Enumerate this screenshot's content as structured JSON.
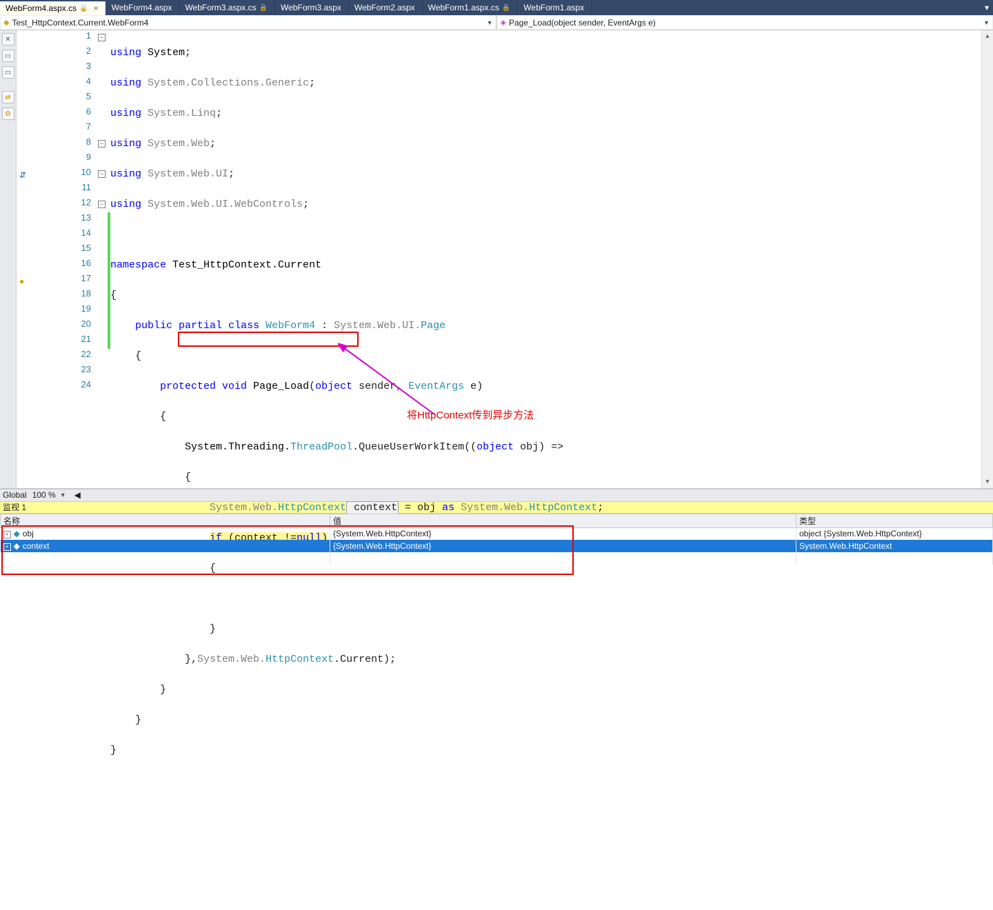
{
  "tabs": [
    {
      "label": "WebForm4.aspx.cs",
      "locked": true,
      "active": true,
      "closeable": true
    },
    {
      "label": "WebForm4.aspx"
    },
    {
      "label": "WebForm3.aspx.cs",
      "locked": true
    },
    {
      "label": "WebForm3.aspx"
    },
    {
      "label": "WebForm2.aspx"
    },
    {
      "label": "WebForm1.aspx.cs",
      "locked": true
    },
    {
      "label": "WebForm1.aspx"
    }
  ],
  "nav": {
    "left": "Test_HttpContext.Current.WebForm4",
    "right": "Page_Load(object sender, EventArgs e)"
  },
  "code": {
    "lines": [
      {
        "n": 1,
        "fold": "-"
      },
      {
        "n": 2
      },
      {
        "n": 3
      },
      {
        "n": 4
      },
      {
        "n": 5
      },
      {
        "n": 6
      },
      {
        "n": 7
      },
      {
        "n": 8,
        "fold": "-"
      },
      {
        "n": 9
      },
      {
        "n": 10,
        "fold": "-",
        "glyph": "impl"
      },
      {
        "n": 11
      },
      {
        "n": 12,
        "fold": "-"
      },
      {
        "n": 13,
        "chg": true
      },
      {
        "n": 14,
        "chg": true
      },
      {
        "n": 15,
        "chg": true
      },
      {
        "n": 16,
        "chg": true
      },
      {
        "n": 17,
        "chg": true,
        "glyph": "bp"
      },
      {
        "n": 18,
        "chg": true
      },
      {
        "n": 19,
        "chg": true
      },
      {
        "n": 20,
        "chg": true
      },
      {
        "n": 21,
        "chg": true
      },
      {
        "n": 22
      },
      {
        "n": 23
      },
      {
        "n": 24
      }
    ],
    "tokens": {
      "using": "using",
      "namespace": "namespace",
      "public": "public",
      "partial": "partial",
      "class": "class",
      "protected": "protected",
      "void": "void",
      "object": "object",
      "as": "as",
      "if": "if",
      "null": "null"
    },
    "idents": {
      "System": "System",
      "Collections_Generic": "System.Collections.Generic",
      "Linq": "System.Linq",
      "Web": "System.Web",
      "Web_UI": "System.Web.UI",
      "Web_UI_WebControls": "System.Web.UI.WebControls",
      "ns": "Test_HttpContext.Current",
      "WebForm4": "WebForm4",
      "Page": "Page",
      "Page_Load": "Page_Load",
      "sender": " sender",
      "EventArgs": "EventArgs",
      "e": " e",
      "ThreadPool": "System.Threading.",
      "ThreadPoolT": "ThreadPool",
      "Queue": ".QueueUserWorkItem((",
      "obj": " obj",
      "lambda": ") =>",
      "SysWeb": "System.Web.",
      "HttpContext": "HttpContext",
      "context": " context",
      "eq": " = obj ",
      "semi": ";",
      "ifcond": " (context !=",
      "closepar": ")",
      "Current": ".Current)",
      "SystemWebUI": "System.Web.UI."
    }
  },
  "annotation": "将HttpContext传到异步方法",
  "footer": {
    "left": "Global",
    "zoom": "100 %"
  },
  "watch": {
    "title": "监视 1",
    "headers": {
      "name": "名称",
      "value": "值",
      "type": "类型"
    },
    "rows": [
      {
        "name": "obj",
        "value": "{System.Web.HttpContext}",
        "type": "object {System.Web.HttpContext}",
        "sel": false
      },
      {
        "name": "context",
        "value": "{System.Web.HttpContext}",
        "type": "System.Web.HttpContext",
        "sel": true
      }
    ]
  }
}
